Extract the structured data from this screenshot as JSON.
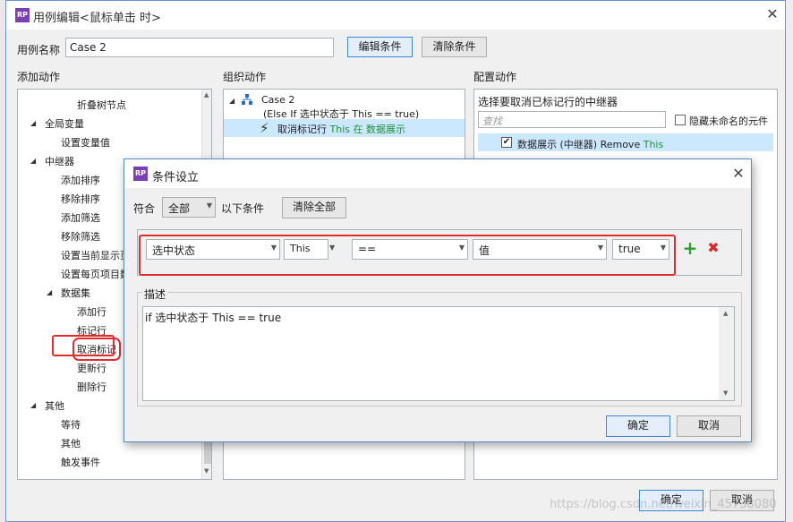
{
  "main": {
    "title": "用例编辑<鼠标单击 时>",
    "usecase_label": "用例名称",
    "usecase_value": "Case 2",
    "edit_condition": "编辑条件",
    "clear_condition": "清除条件",
    "col_add": "添加动作",
    "col_org": "组织动作",
    "col_cfg": "配置动作",
    "ok": "确定",
    "cancel": "取消"
  },
  "add_tree": [
    {
      "label": "折叠树节点",
      "level": 3
    },
    {
      "label": "全局变量",
      "level": 1,
      "expanded": true
    },
    {
      "label": "设置变量值",
      "level": 2
    },
    {
      "label": "中继器",
      "level": 1,
      "expanded": true
    },
    {
      "label": "添加排序",
      "level": 2
    },
    {
      "label": "移除排序",
      "level": 2
    },
    {
      "label": "添加筛选",
      "level": 2
    },
    {
      "label": "移除筛选",
      "level": 2
    },
    {
      "label": "设置当前显示页",
      "level": 2
    },
    {
      "label": "设置每页项目数",
      "level": 2
    },
    {
      "label": "数据集",
      "level": 2,
      "expanded": true
    },
    {
      "label": "添加行",
      "level": 3
    },
    {
      "label": "标记行",
      "level": 3
    },
    {
      "label": "取消标记",
      "level": 3,
      "highlighted": true
    },
    {
      "label": "更新行",
      "level": 3
    },
    {
      "label": "删除行",
      "level": 3
    },
    {
      "label": "其他",
      "level": 1,
      "expanded": true
    },
    {
      "label": "等待",
      "level": 2
    },
    {
      "label": "其他",
      "level": 2
    },
    {
      "label": "触发事件",
      "level": 2
    }
  ],
  "org": {
    "case_name": "Case 2",
    "case_condition": "(Else If 选中状态于 This == true)",
    "action_prefix": "取消标记行 ",
    "action_this": "This",
    "action_suffix": " 在 数据展示"
  },
  "cfg": {
    "heading": "选择要取消已标记行的中继器",
    "search_placeholder": "查找",
    "hide_unnamed": "隐藏未命名的元件",
    "row_name": "数据展示 (中继器) Remove ",
    "row_this": "This",
    "row_checked": true
  },
  "cond": {
    "title": "条件设立",
    "match_label": "符合",
    "match_value": "全部",
    "match_suffix": "以下条件",
    "clear_all": "清除全部",
    "field": "选中状态",
    "target": "This",
    "operator": "==",
    "value_type": "值",
    "value": "true",
    "desc_label": "描述",
    "desc_text": "if 选中状态于 This == true",
    "ok": "确定",
    "cancel": "取消"
  },
  "watermark": "https://blog.csdn.net/weixin_45738080",
  "colors": {
    "accent": "#3e86d6",
    "highlight": "#e22c2c",
    "selection": "#cce8ff",
    "green_text": "#1f8f3a"
  }
}
